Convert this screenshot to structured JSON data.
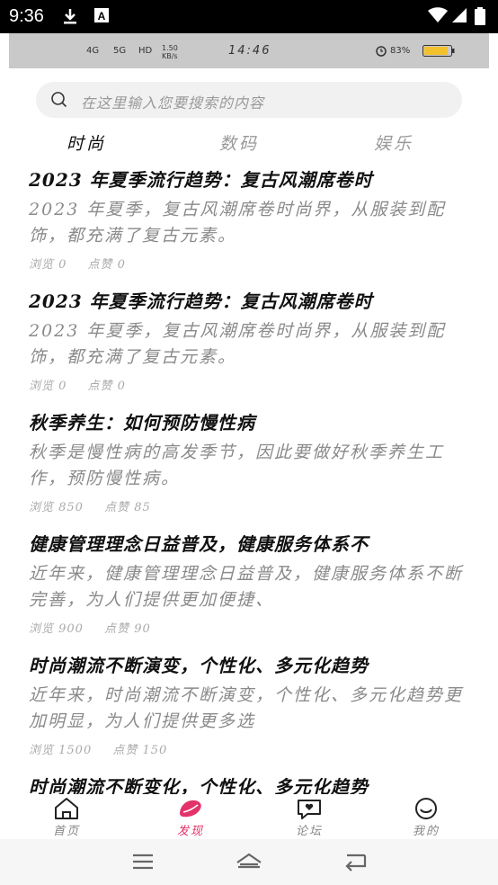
{
  "system": {
    "time": "9:36"
  },
  "inner_status": {
    "signal1": "4G",
    "signal2": "5G",
    "hd": "HD",
    "speed": "1.50 KB/s",
    "time": "14:46",
    "battery": "83%"
  },
  "search": {
    "placeholder": "在这里输入您要搜索的内容"
  },
  "tabs": [
    {
      "label": "时尚"
    },
    {
      "label": "数码"
    },
    {
      "label": "娱乐"
    }
  ],
  "feed": [
    {
      "title": "2023 年夏季流行趋势：复古风潮席卷时",
      "desc": "2023 年夏季，复古风潮席卷时尚界，从服装到配饰，都充满了复古元素。",
      "views": "浏览 0",
      "likes": "点赞 0"
    },
    {
      "title": "2023 年夏季流行趋势：复古风潮席卷时",
      "desc": "2023 年夏季，复古风潮席卷时尚界，从服装到配饰，都充满了复古元素。",
      "views": "浏览 0",
      "likes": "点赞 0"
    },
    {
      "title": "秋季养生：如何预防慢性病",
      "desc": "秋季是慢性病的高发季节，因此要做好秋季养生工作，预防慢性病。",
      "views": "浏览 850",
      "likes": "点赞 85"
    },
    {
      "title": "健康管理理念日益普及，健康服务体系不",
      "desc": "近年来，健康管理理念日益普及，健康服务体系不断完善，为人们提供更加便捷、",
      "views": "浏览 900",
      "likes": "点赞 90"
    },
    {
      "title": "时尚潮流不断演变，个性化、多元化趋势",
      "desc": "近年来，时尚潮流不断演变，个性化、多元化趋势更加明显，为人们提供更多选",
      "views": "浏览 1500",
      "likes": "点赞 150"
    },
    {
      "title": "时尚潮流不断变化，个性化、多元化趋势",
      "desc": "",
      "views": "",
      "likes": ""
    }
  ],
  "nav": [
    {
      "label": "首页"
    },
    {
      "label": "发现"
    },
    {
      "label": "论坛"
    },
    {
      "label": "我的"
    }
  ],
  "colors": {
    "accent": "#e3336a",
    "text_primary": "#111111",
    "text_secondary": "#8a8a8a"
  }
}
